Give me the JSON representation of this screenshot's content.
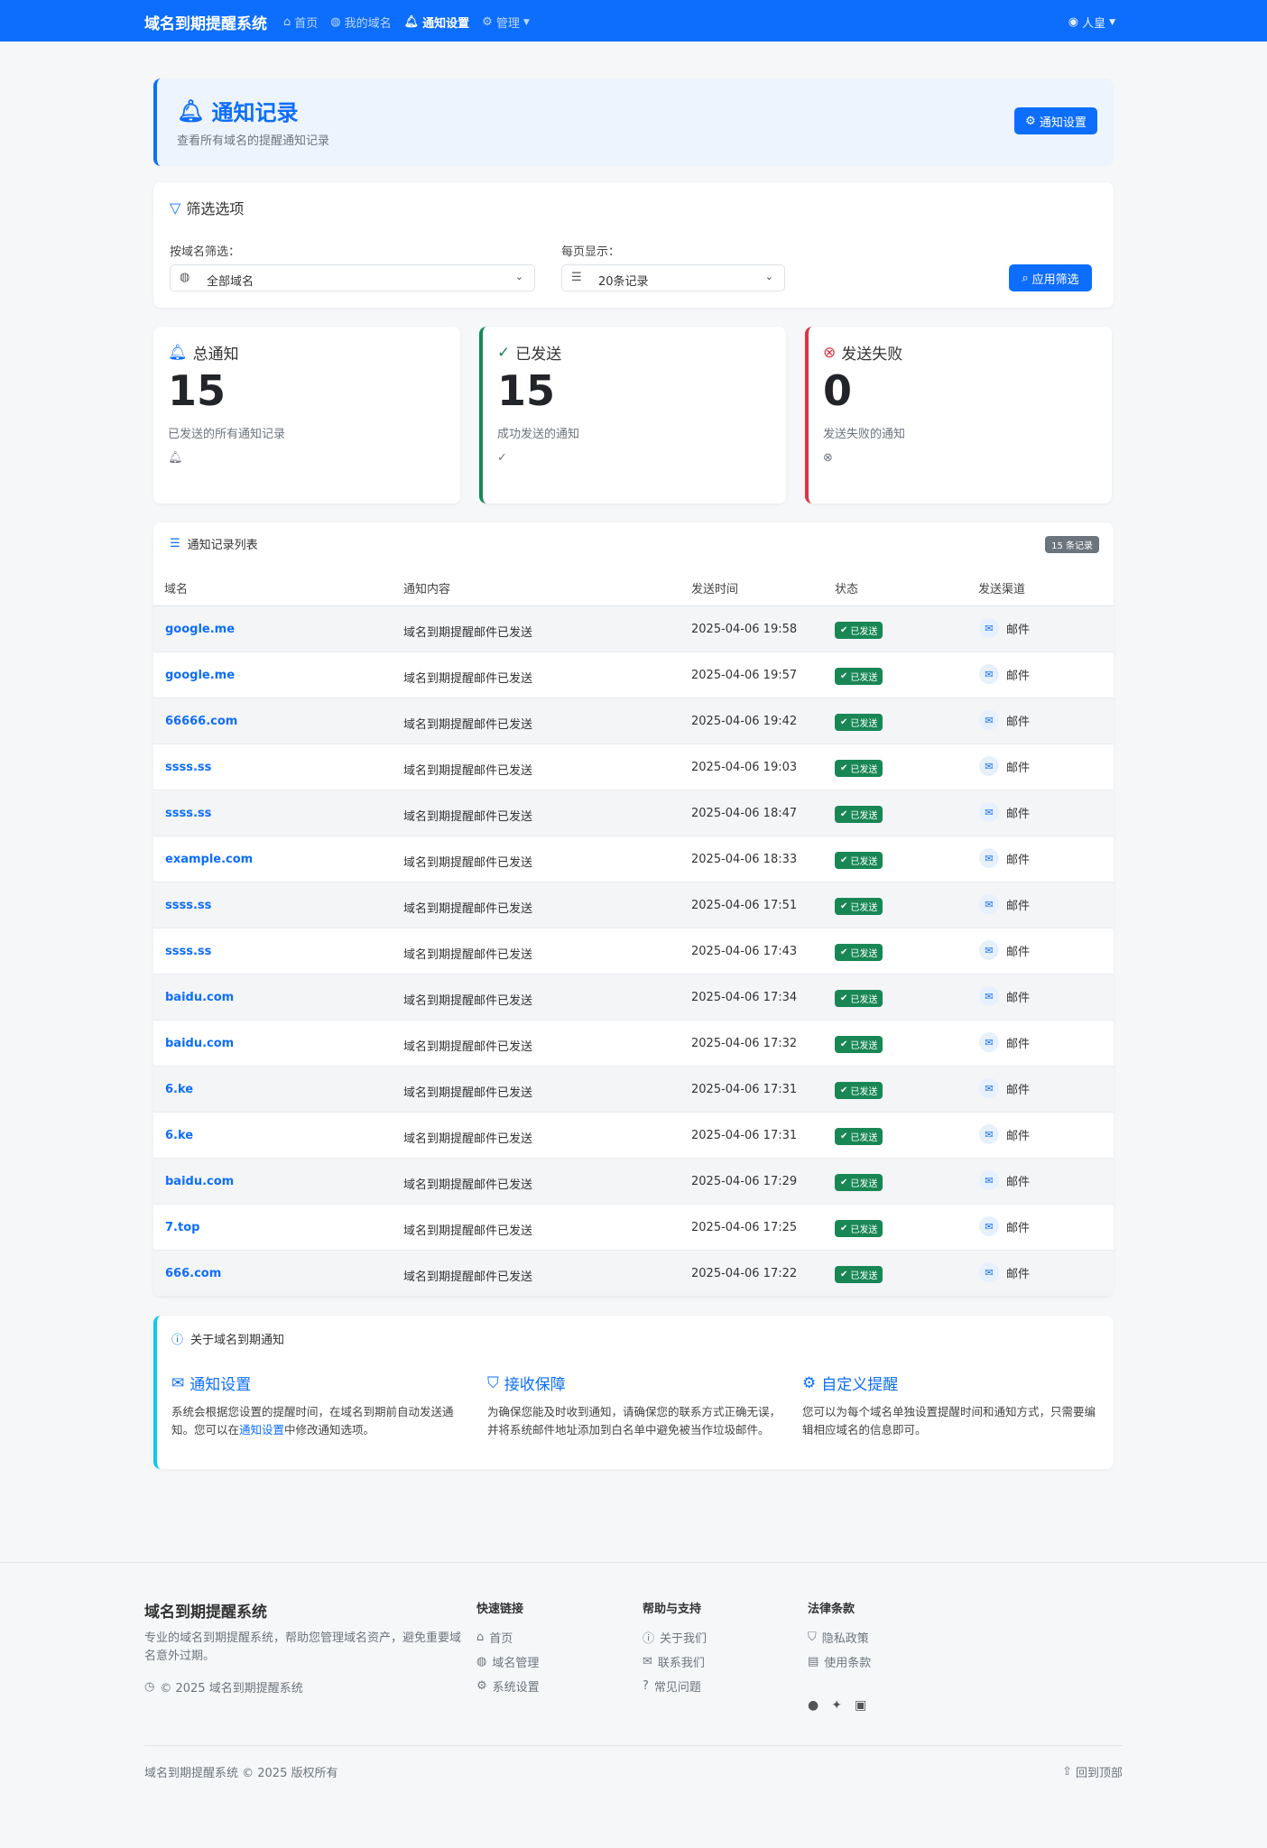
{
  "nav": {
    "brand": "域名到期提醒系统",
    "links": [
      {
        "icon": "⌂",
        "label": "首页"
      },
      {
        "icon": "◍",
        "label": "我的域名"
      },
      {
        "icon": "🔔",
        "label": "通知设置"
      },
      {
        "icon": "⚙",
        "label": "管理"
      }
    ],
    "user": "人皇"
  },
  "header": {
    "title": "通知记录",
    "subtitle": "查看所有域名的提醒通知记录",
    "button": "通知设置"
  },
  "filter": {
    "title": "筛选选项",
    "domain_label": "按域名筛选：",
    "domain_value": "全部域名",
    "perpage_label": "每页显示：",
    "perpage_value": "20条记录",
    "apply": "应用筛选"
  },
  "stats": [
    {
      "title": "总通知",
      "value": "15",
      "desc": "已发送的所有通知记录"
    },
    {
      "title": "已发送",
      "value": "15",
      "desc": "成功发送的通知"
    },
    {
      "title": "发送失败",
      "value": "0",
      "desc": "发送失败的通知"
    }
  ],
  "table": {
    "title": "通知记录列表",
    "badge": "15 条记录",
    "columns": [
      "域名",
      "通知内容",
      "发送时间",
      "状态",
      "发送渠道"
    ],
    "rows": [
      {
        "domain": "google.me",
        "content": "域名到期提醒邮件已发送",
        "time": "2025-04-06 19:58",
        "status": "已发送",
        "channel": "邮件"
      },
      {
        "domain": "google.me",
        "content": "域名到期提醒邮件已发送",
        "time": "2025-04-06 19:57",
        "status": "已发送",
        "channel": "邮件"
      },
      {
        "domain": "66666.com",
        "content": "域名到期提醒邮件已发送",
        "time": "2025-04-06 19:42",
        "status": "已发送",
        "channel": "邮件"
      },
      {
        "domain": "ssss.ss",
        "content": "域名到期提醒邮件已发送",
        "time": "2025-04-06 19:03",
        "status": "已发送",
        "channel": "邮件"
      },
      {
        "domain": "ssss.ss",
        "content": "域名到期提醒邮件已发送",
        "time": "2025-04-06 18:47",
        "status": "已发送",
        "channel": "邮件"
      },
      {
        "domain": "example.com",
        "content": "域名到期提醒邮件已发送",
        "time": "2025-04-06 18:33",
        "status": "已发送",
        "channel": "邮件"
      },
      {
        "domain": "ssss.ss",
        "content": "域名到期提醒邮件已发送",
        "time": "2025-04-06 17:51",
        "status": "已发送",
        "channel": "邮件"
      },
      {
        "domain": "ssss.ss",
        "content": "域名到期提醒邮件已发送",
        "time": "2025-04-06 17:43",
        "status": "已发送",
        "channel": "邮件"
      },
      {
        "domain": "baidu.com",
        "content": "域名到期提醒邮件已发送",
        "time": "2025-04-06 17:34",
        "status": "已发送",
        "channel": "邮件"
      },
      {
        "domain": "baidu.com",
        "content": "域名到期提醒邮件已发送",
        "time": "2025-04-06 17:32",
        "status": "已发送",
        "channel": "邮件"
      },
      {
        "domain": "6.ke",
        "content": "域名到期提醒邮件已发送",
        "time": "2025-04-06 17:31",
        "status": "已发送",
        "channel": "邮件"
      },
      {
        "domain": "6.ke",
        "content": "域名到期提醒邮件已发送",
        "time": "2025-04-06 17:31",
        "status": "已发送",
        "channel": "邮件"
      },
      {
        "domain": "baidu.com",
        "content": "域名到期提醒邮件已发送",
        "time": "2025-04-06 17:29",
        "status": "已发送",
        "channel": "邮件"
      },
      {
        "domain": "7.top",
        "content": "域名到期提醒邮件已发送",
        "time": "2025-04-06 17:25",
        "status": "已发送",
        "channel": "邮件"
      },
      {
        "domain": "666.com",
        "content": "域名到期提醒邮件已发送",
        "time": "2025-04-06 17:22",
        "status": "已发送",
        "channel": "邮件"
      }
    ]
  },
  "about": {
    "title": "关于域名到期通知",
    "col1_title": "通知设置",
    "col1_text_a": "系统会根据您设置的提醒时间，在域名到期前自动发送通知。您可以在",
    "col1_link": "通知设置",
    "col1_text_b": "中修改通知选项。",
    "col2_title": "接收保障",
    "col2_text": "为确保您能及时收到通知，请确保您的联系方式正确无误，并将系统邮件地址添加到白名单中避免被当作垃圾邮件。",
    "col3_title": "自定义提醒",
    "col3_text": "您可以为每个域名单独设置提醒时间和通知方式，只需要编辑相应域名的信息即可。"
  },
  "footer": {
    "brand": "域名到期提醒系统",
    "desc": "专业的域名到期提醒系统，帮助您管理域名资产，避免重要域名意外过期。",
    "copy": "© 2025 域名到期提醒系统",
    "quick_title": "快速链接",
    "quick": [
      "首页",
      "域名管理",
      "系统设置"
    ],
    "help_title": "帮助与支持",
    "help": [
      "关于我们",
      "联系我们",
      "常见问题"
    ],
    "legal_title": "法律条款",
    "legal": [
      "隐私政策",
      "使用条款"
    ],
    "bottom": "域名到期提醒系统 © 2025 版权所有",
    "back_top": "回到顶部"
  },
  "colors": {
    "primary": "#0d6efd",
    "success": "#198754",
    "danger": "#dc3545",
    "info": "#0dcaf0"
  },
  "icons": [
    "bell-icon",
    "gear-icon",
    "filter-icon",
    "globe-icon",
    "list-icon",
    "check-circle-icon",
    "x-circle-icon",
    "search-icon",
    "mail-icon",
    "info-icon",
    "shield-icon",
    "home-icon",
    "user-icon",
    "github-icon",
    "twitter-icon",
    "linkedin-icon",
    "arrow-up-icon",
    "clock-icon"
  ]
}
